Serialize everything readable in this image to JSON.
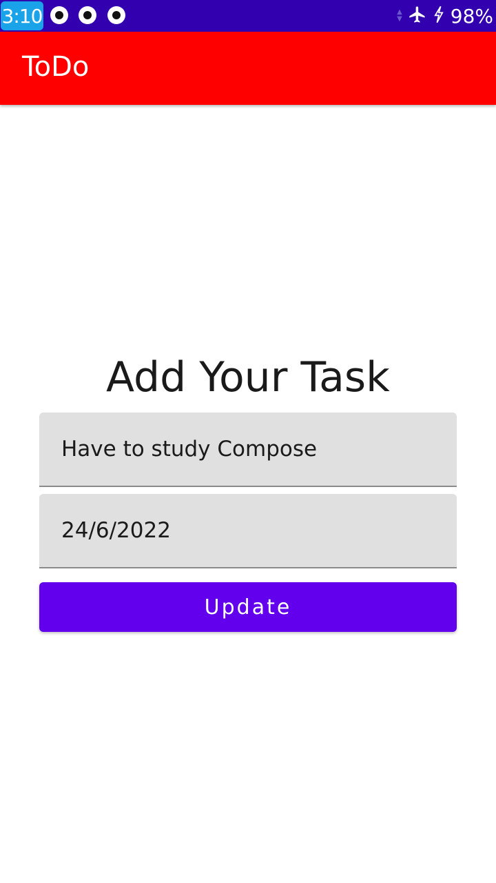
{
  "status_bar": {
    "time": "3:10",
    "notification_icons": [
      "app-notification-icon",
      "app-notification-icon",
      "app-notification-icon"
    ],
    "signal_icon": "data-arrows-icon",
    "airplane_icon": "airplane-mode-icon",
    "charging_icon": "charging-bolt-icon",
    "battery": "98%",
    "background_color": "#3300b0",
    "clock_badge_color": "#1aa3e8"
  },
  "app_bar": {
    "title": "ToDo",
    "color": "#ff0000"
  },
  "form": {
    "heading": "Add Your Task",
    "task_field": {
      "value": "Have to study Compose"
    },
    "date_field": {
      "value": "24/6/2022"
    },
    "submit_label": "Update",
    "submit_color": "#6200ee"
  }
}
